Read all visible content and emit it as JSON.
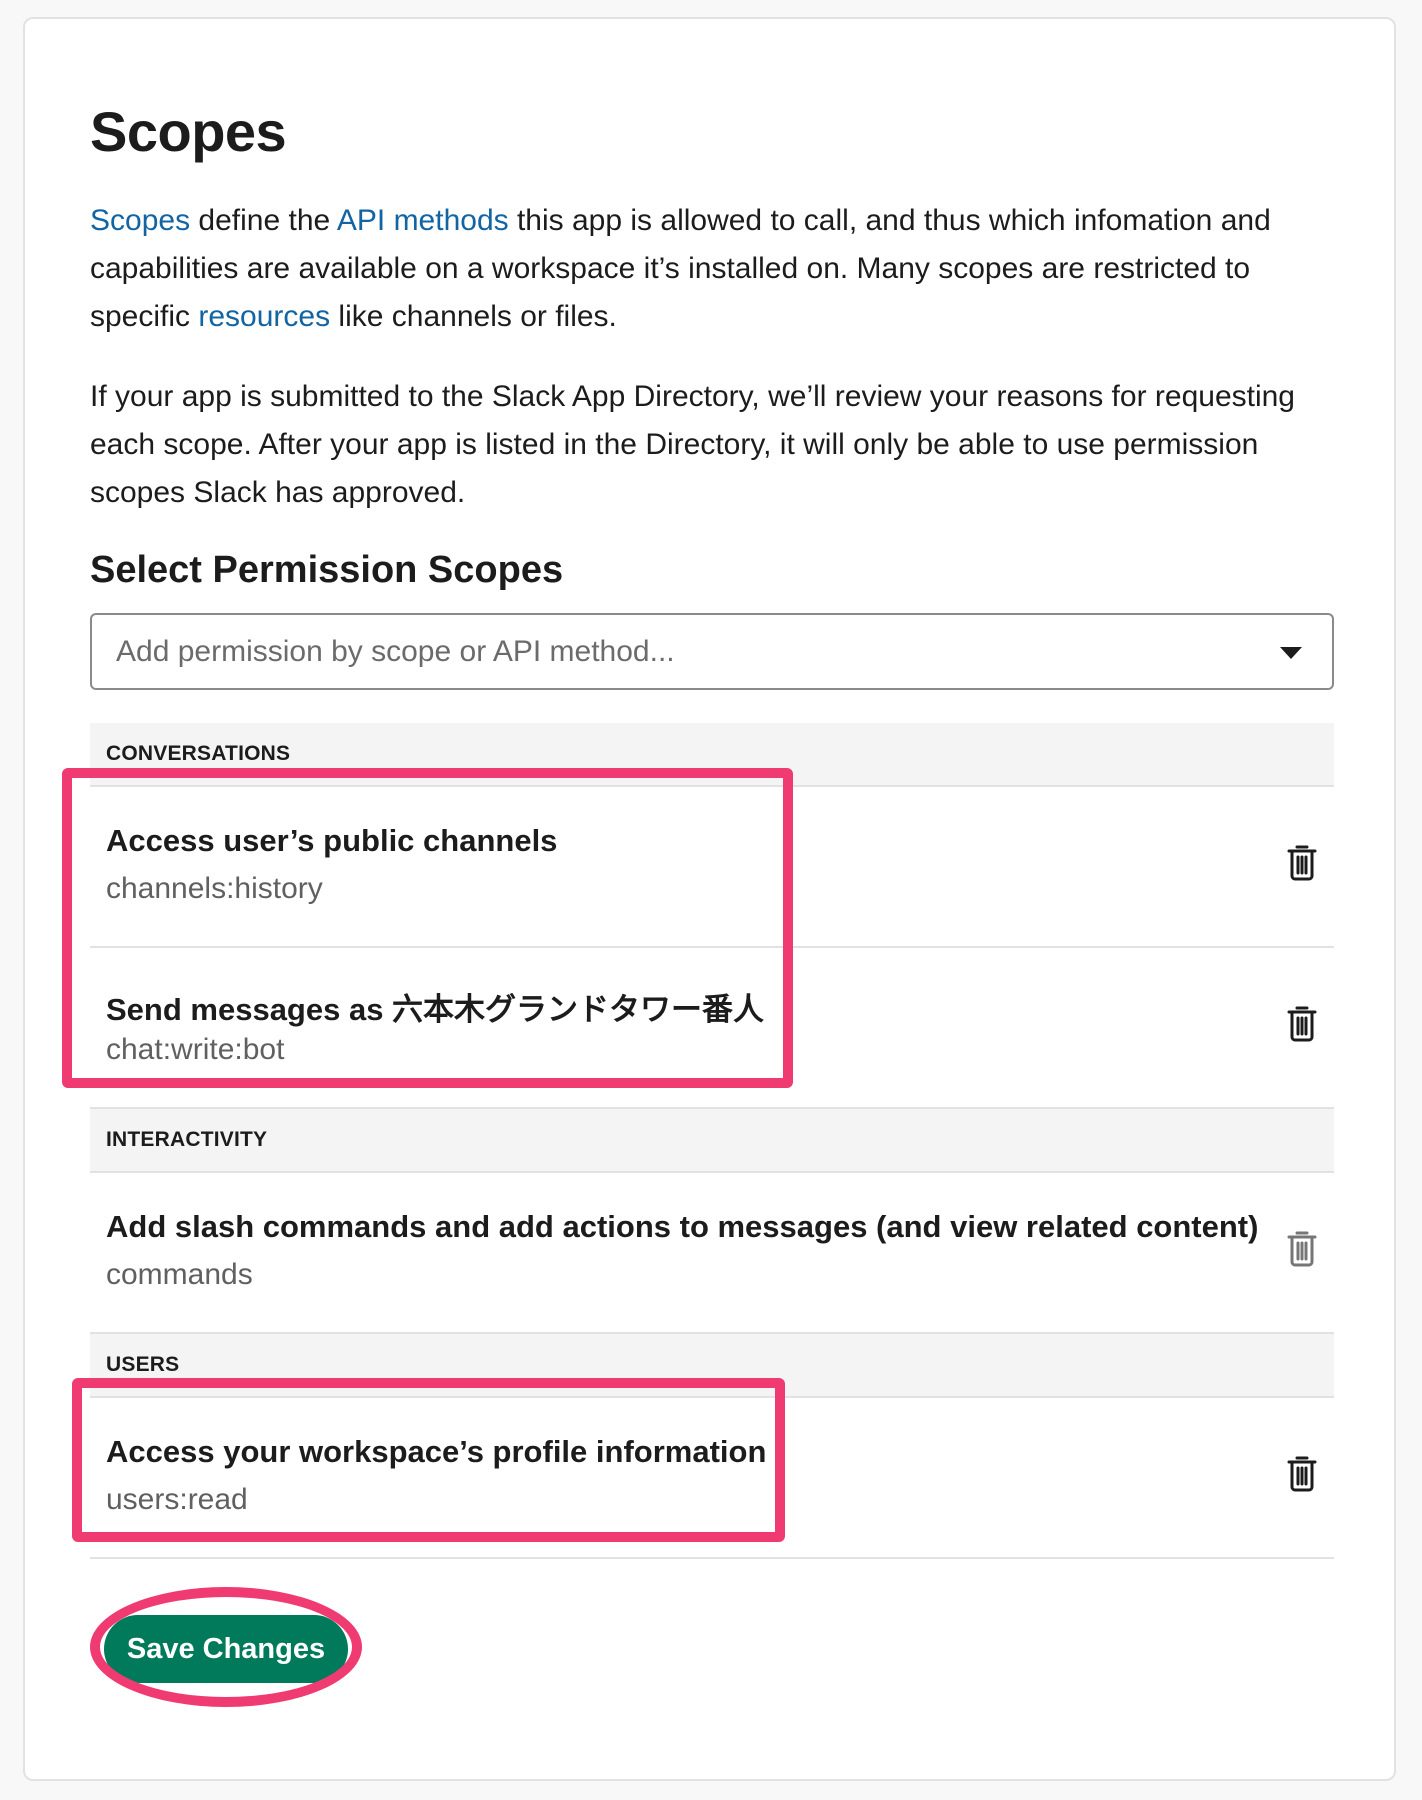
{
  "header": {
    "title": "Scopes"
  },
  "intro": {
    "link_scopes": "Scopes",
    "text_1": " define the ",
    "link_api": "API methods",
    "text_2": " this app is allowed to call, and thus which infomation and capabilities are available on a workspace it’s installed on. Many scopes are restricted to specific ",
    "link_resources": "resources",
    "text_3": " like channels or files."
  },
  "review_note": "If your app is submitted to the Slack App Directory, we’ll review your reasons for requesting each scope. After your app is listed in the Directory, it will only be able to use permission scopes Slack has approved.",
  "permissions": {
    "heading": "Select Permission Scopes",
    "select_placeholder": "Add permission by scope or API method..."
  },
  "sections": [
    {
      "name": "CONVERSATIONS",
      "scopes": [
        {
          "title": "Access user’s public channels",
          "code": "channels:history"
        },
        {
          "title": "Send messages as 六本木グランドタワー番人",
          "code": "chat:write:bot"
        }
      ]
    },
    {
      "name": "INTERACTIVITY",
      "scopes": [
        {
          "title": "Add slash commands and add actions to messages (and view related content)",
          "code": "commands"
        }
      ]
    },
    {
      "name": "USERS",
      "scopes": [
        {
          "title": "Access your workspace’s profile information",
          "code": "users:read"
        }
      ]
    }
  ],
  "actions": {
    "save_label": "Save Changes"
  },
  "colors": {
    "link": "#1264a3",
    "save_button": "#007a5a",
    "highlight": "#f03b72"
  }
}
